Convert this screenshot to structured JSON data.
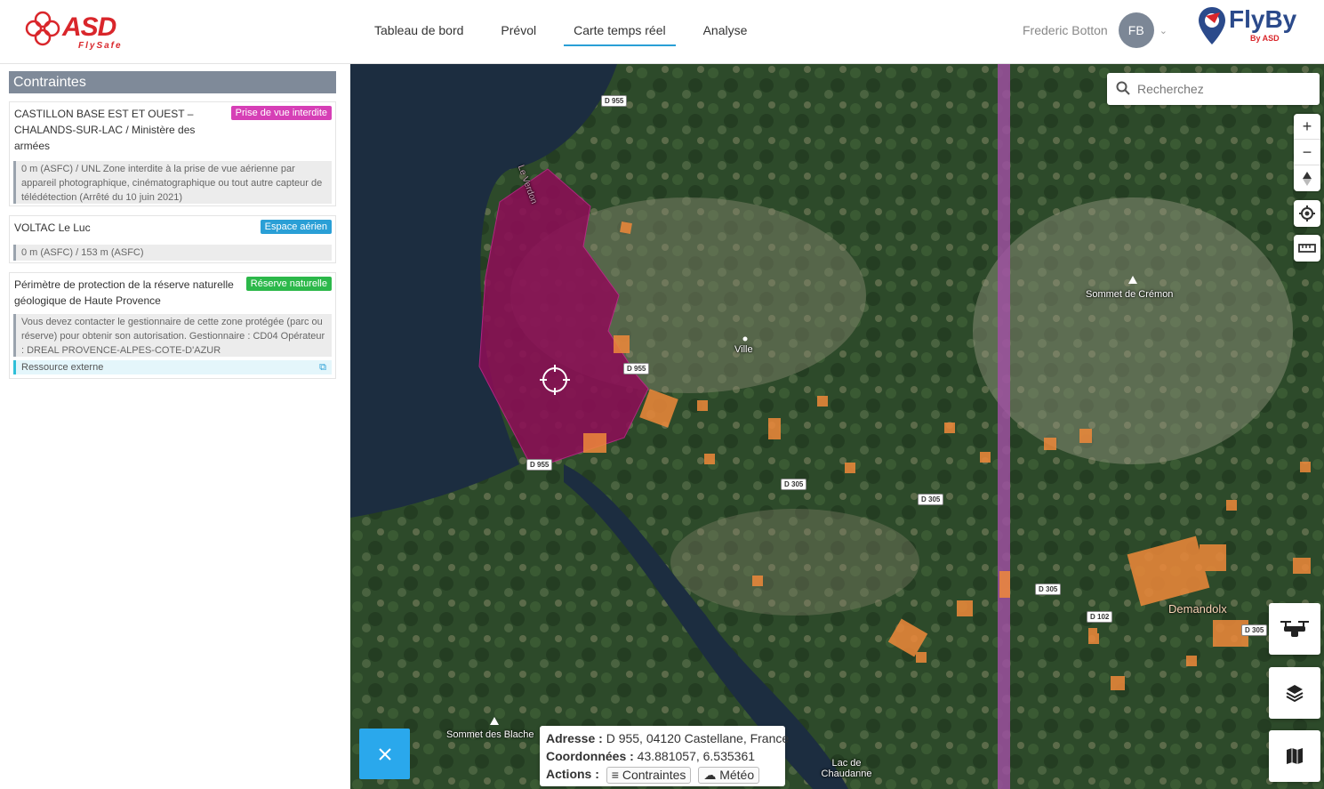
{
  "header": {
    "logo_left": {
      "brand": "ASD",
      "tagline": "FlySafe"
    },
    "nav": [
      {
        "label": "Tableau de bord",
        "active": false
      },
      {
        "label": "Prévol",
        "active": false
      },
      {
        "label": "Carte temps réel",
        "active": true
      },
      {
        "label": "Analyse",
        "active": false
      }
    ],
    "user": {
      "name": "Frederic Botton",
      "initials": "FB"
    },
    "logo_right": {
      "brand": "FlyBy",
      "byline": "By ASD"
    }
  },
  "sidebar": {
    "title": "Contraintes",
    "constraints": [
      {
        "name": "CASTILLON BASE EST ET OUEST –\nCHALANDS-SUR-LAC / Ministère des\narmées",
        "badge": "Prise de vue interdite",
        "badge_color": "#d63fb6",
        "description": "0 m (ASFC) / UNL Zone interdite à la prise de vue aérienne par appareil photographique, cinématographique ou tout autre capteur de télédétection (Arrêté du 10 juin 2021)"
      },
      {
        "name": "VOLTAC Le Luc",
        "badge": "Espace aérien",
        "badge_color": "#2a9fd6",
        "description": "0 m (ASFC) / 153 m (ASFC)"
      },
      {
        "name": "Périmètre de protection de la réserve naturelle\ngéologique de Haute Provence",
        "badge": "Réserve naturelle",
        "badge_color": "#2cb84a",
        "description": "Vous devez contacter le gestionnaire de cette zone protégée (parc ou réserve) pour obtenir son autorisation. Gestionnaire : CD04 Opérateur : DREAL PROVENCE-ALPES-COTE-D'AZUR",
        "link_label": "Ressource externe"
      }
    ]
  },
  "map": {
    "search_placeholder": "Recherchez",
    "place_labels": [
      "Ville",
      "Sommet de Crémon",
      "Demandolx",
      "Sommet des Blache",
      "Lac de Chaudanne",
      "Le Verdon"
    ],
    "road_labels": [
      "D 955",
      "D 955",
      "D 955",
      "D 305",
      "D 305",
      "D 305",
      "D 102",
      "D 305"
    ],
    "popup": {
      "address_label": "Adresse :",
      "address_value": "D 955, 04120 Castellane, France",
      "coords_label": "Coordonnées :",
      "coords_value": "43.881057, 6.535361",
      "actions_label": "Actions :",
      "action_constraints": "Contraintes",
      "action_weather": "Météo"
    },
    "icons": [
      "search-icon",
      "zoom-in-icon",
      "zoom-out-icon",
      "compass-icon",
      "locate-icon",
      "ruler-icon",
      "drone-icon",
      "layers-icon",
      "map-icon",
      "close-icon"
    ]
  }
}
